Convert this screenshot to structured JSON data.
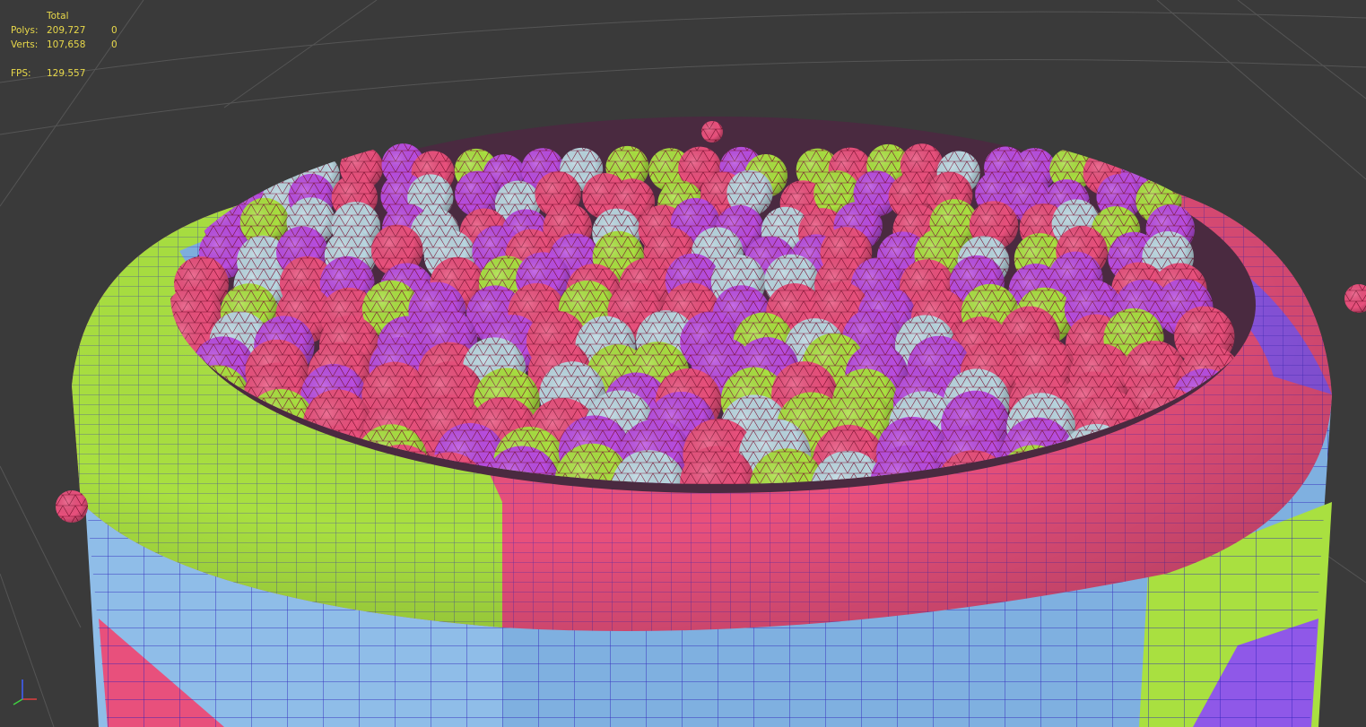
{
  "viewport": {
    "background": "#3a3a3a",
    "grid_color": "#555555",
    "wire_color": "#2b1fb8",
    "ball_wire_color": "#7a1030",
    "palette": {
      "pink": "#e8507c",
      "lime": "#a9e040",
      "magenta": "#b84de0",
      "silver": "#b9d6e0",
      "blue": "#7fb0e0",
      "violet": "#8f58e8"
    }
  },
  "stats": {
    "header": "Total",
    "polys_label": "Polys:",
    "polys_total": "209,727",
    "polys_selected": "0",
    "verts_label": "Verts:",
    "verts_total": "107,658",
    "verts_selected": "0",
    "fps_label": "FPS:",
    "fps_value": "129.557",
    "text_color": "#e8d84a"
  },
  "gizmo": {
    "icon": "axis-gizmo-icon",
    "axes": [
      "x",
      "y",
      "z"
    ]
  }
}
